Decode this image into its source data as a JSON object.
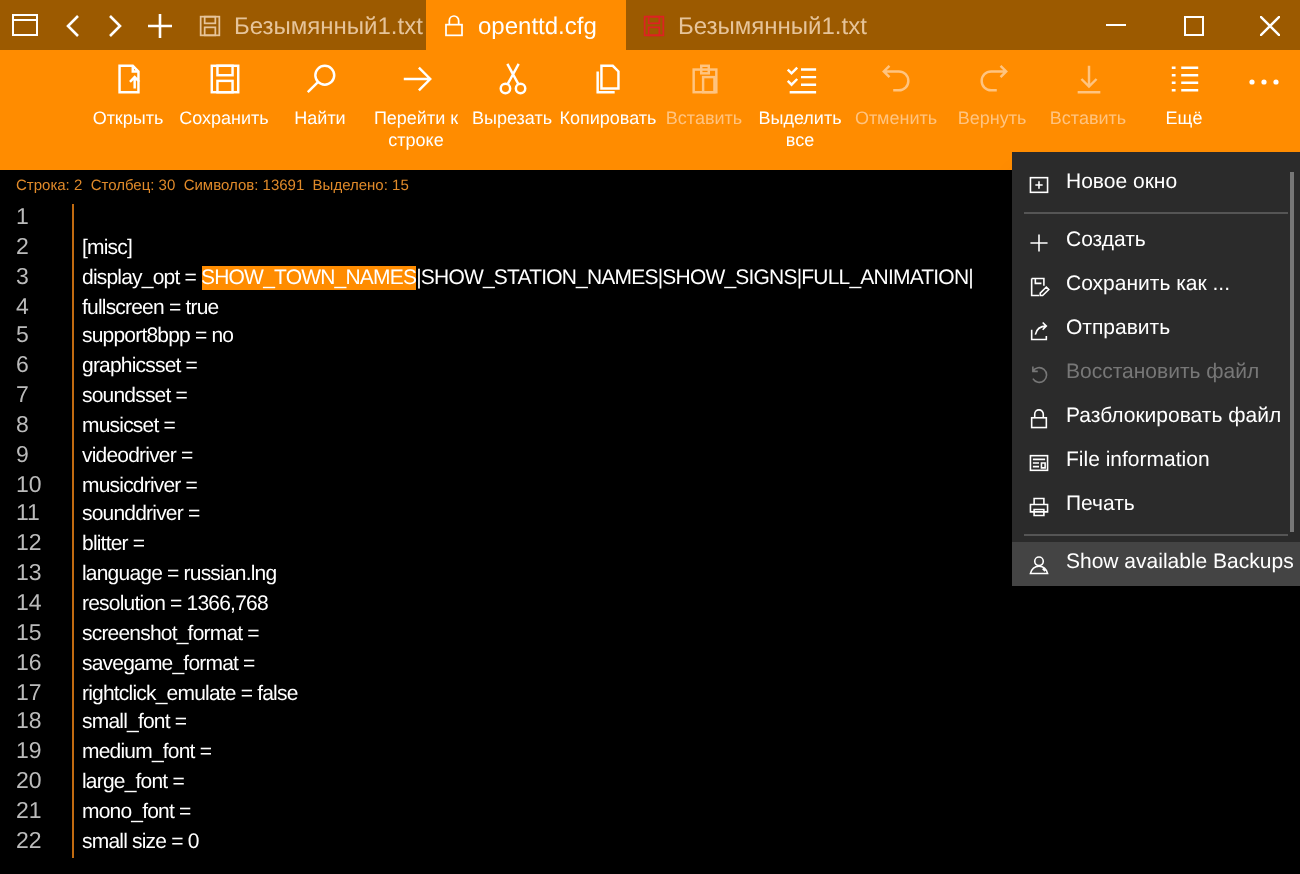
{
  "tabs": [
    {
      "label": "Безымянный1.txt",
      "selected": false,
      "unsaved": false
    },
    {
      "label": "openttd.cfg",
      "selected": true,
      "unsaved": false
    },
    {
      "label": "Безымянный1.txt",
      "selected": false,
      "unsaved": true
    }
  ],
  "toolbar": [
    {
      "label": "Открыть",
      "disabled": false
    },
    {
      "label": "Сохранить",
      "disabled": false
    },
    {
      "label": "Найти",
      "disabled": false
    },
    {
      "label": "Перейти к строке",
      "disabled": false
    },
    {
      "label": "Вырезать",
      "disabled": false
    },
    {
      "label": "Копировать",
      "disabled": false
    },
    {
      "label": "Вставить",
      "disabled": true
    },
    {
      "label": "Выделить все",
      "disabled": false
    },
    {
      "label": "Отменить",
      "disabled": true
    },
    {
      "label": "Вернуть",
      "disabled": true
    },
    {
      "label": "Вставить",
      "disabled": true
    },
    {
      "label": "Ещё",
      "disabled": false
    }
  ],
  "status_bar": "Строка: 2  Столбец: 30  Символов: 13691  Выделено: 15",
  "lines": [
    {
      "number": "1"
    },
    {
      "number": "2",
      "text": "[misc]"
    },
    {
      "number": "3",
      "text": "display_opt = ",
      "selected_text": "SHOW_TOWN_NAMES",
      "after": "|SHOW_STATION_NAMES|SHOW_SIGNS|FULL_ANIMATION|"
    },
    {
      "number": "4",
      "text": "fullscreen = true"
    },
    {
      "number": "5",
      "text": "support8bpp = no"
    },
    {
      "number": "6",
      "text": "graphicsset ="
    },
    {
      "number": "7",
      "text": "soundsset ="
    },
    {
      "number": "8",
      "text": "musicset ="
    },
    {
      "number": "9",
      "text": "videodriver ="
    },
    {
      "number": "10",
      "text": "musicdriver ="
    },
    {
      "number": "11",
      "text": "sounddriver ="
    },
    {
      "number": "12",
      "text": "blitter ="
    },
    {
      "number": "13",
      "text": "language = russian.lng"
    },
    {
      "number": "14",
      "text": "resolution = 1366,768"
    },
    {
      "number": "15",
      "text": "screenshot_format ="
    },
    {
      "number": "16",
      "text": "savegame_format ="
    },
    {
      "number": "17",
      "text": "rightclick_emulate = false"
    },
    {
      "number": "18",
      "text": "small_font ="
    },
    {
      "number": "19",
      "text": "medium_font ="
    },
    {
      "number": "20",
      "text": "large_font ="
    },
    {
      "number": "21",
      "text": "mono_font ="
    },
    {
      "number": "22",
      "text": "small size = 0"
    }
  ],
  "menu": [
    {
      "label": "Новое окно",
      "disabled": false,
      "selected": false,
      "separator_after": true
    },
    {
      "label": "Создать",
      "disabled": false,
      "selected": false,
      "separator_after": false
    },
    {
      "label": "Сохранить как ...",
      "disabled": false,
      "selected": false,
      "separator_after": false
    },
    {
      "label": "Отправить",
      "disabled": false,
      "selected": false,
      "separator_after": false
    },
    {
      "label": "Восстановить файл",
      "disabled": true,
      "selected": false,
      "separator_after": false
    },
    {
      "label": "Разблокировать файл",
      "disabled": false,
      "selected": false,
      "separator_after": false
    },
    {
      "label": "File information",
      "disabled": false,
      "selected": false,
      "separator_after": false
    },
    {
      "label": "Печать",
      "disabled": false,
      "selected": false,
      "separator_after": true
    },
    {
      "label": "Show available Backups",
      "disabled": false,
      "selected": true,
      "separator_after": false
    }
  ]
}
